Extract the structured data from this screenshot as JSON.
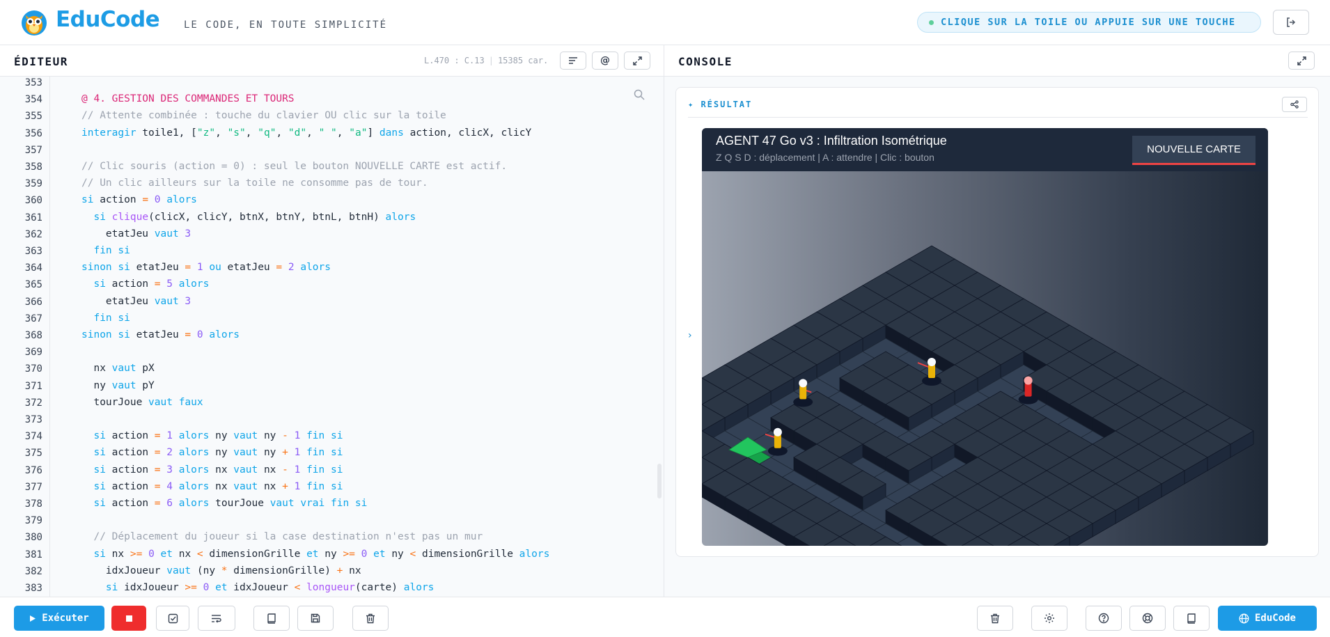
{
  "header": {
    "brand": "EduCode",
    "tagline": "LE CODE, EN TOUTE SIMPLICITÉ",
    "hint": "CLIQUE SUR LA TOILE OU APPUIE SUR UNE TOUCHE"
  },
  "editor": {
    "title": "ÉDITEUR",
    "cursor": "L.470 : C.13",
    "chars": "15385 car.",
    "first_line": 353,
    "lines": [
      [],
      [
        {
          "t": "@ 4. GESTION DES COMMANDES ET TOURS",
          "c": "sec"
        }
      ],
      [
        {
          "t": "// Attente combinée : touche du clavier OU clic sur la toile",
          "c": "cm"
        }
      ],
      [
        {
          "t": "interagir",
          "c": "kw"
        },
        {
          "t": " toile1, ["
        },
        {
          "t": "\"z\"",
          "c": "str"
        },
        {
          "t": ", "
        },
        {
          "t": "\"s\"",
          "c": "str"
        },
        {
          "t": ", "
        },
        {
          "t": "\"q\"",
          "c": "str"
        },
        {
          "t": ", "
        },
        {
          "t": "\"d\"",
          "c": "str"
        },
        {
          "t": ", "
        },
        {
          "t": "\" \"",
          "c": "str"
        },
        {
          "t": ", "
        },
        {
          "t": "\"a\"",
          "c": "str"
        },
        {
          "t": "] "
        },
        {
          "t": "dans",
          "c": "kw"
        },
        {
          "t": " action, clicX, clicY"
        }
      ],
      [],
      [
        {
          "t": "// Clic souris (action = 0) : seul le bouton NOUVELLE CARTE est actif.",
          "c": "cm"
        }
      ],
      [
        {
          "t": "// Un clic ailleurs sur la toile ne consomme pas de tour.",
          "c": "cm"
        }
      ],
      [
        {
          "t": "si",
          "c": "kw"
        },
        {
          "t": " action "
        },
        {
          "t": "=",
          "c": "op"
        },
        {
          "t": " "
        },
        {
          "t": "0",
          "c": "num"
        },
        {
          "t": " "
        },
        {
          "t": "alors",
          "c": "kw"
        }
      ],
      [
        {
          "t": "  "
        },
        {
          "t": "si",
          "c": "kw"
        },
        {
          "t": " "
        },
        {
          "t": "clique",
          "c": "fn"
        },
        {
          "t": "(clicX, clicY, btnX, btnY, btnL, btnH) "
        },
        {
          "t": "alors",
          "c": "kw"
        }
      ],
      [
        {
          "t": "    etatJeu "
        },
        {
          "t": "vaut",
          "c": "kw"
        },
        {
          "t": " "
        },
        {
          "t": "3",
          "c": "num"
        }
      ],
      [
        {
          "t": "  "
        },
        {
          "t": "fin si",
          "c": "kw"
        }
      ],
      [
        {
          "t": "sinon si",
          "c": "kw"
        },
        {
          "t": " etatJeu "
        },
        {
          "t": "=",
          "c": "op"
        },
        {
          "t": " "
        },
        {
          "t": "1",
          "c": "num"
        },
        {
          "t": " "
        },
        {
          "t": "ou",
          "c": "kw"
        },
        {
          "t": " etatJeu "
        },
        {
          "t": "=",
          "c": "op"
        },
        {
          "t": " "
        },
        {
          "t": "2",
          "c": "num"
        },
        {
          "t": " "
        },
        {
          "t": "alors",
          "c": "kw"
        }
      ],
      [
        {
          "t": "  "
        },
        {
          "t": "si",
          "c": "kw"
        },
        {
          "t": " action "
        },
        {
          "t": "=",
          "c": "op"
        },
        {
          "t": " "
        },
        {
          "t": "5",
          "c": "num"
        },
        {
          "t": " "
        },
        {
          "t": "alors",
          "c": "kw"
        }
      ],
      [
        {
          "t": "    etatJeu "
        },
        {
          "t": "vaut",
          "c": "kw"
        },
        {
          "t": " "
        },
        {
          "t": "3",
          "c": "num"
        }
      ],
      [
        {
          "t": "  "
        },
        {
          "t": "fin si",
          "c": "kw"
        }
      ],
      [
        {
          "t": "sinon si",
          "c": "kw"
        },
        {
          "t": " etatJeu "
        },
        {
          "t": "=",
          "c": "op"
        },
        {
          "t": " "
        },
        {
          "t": "0",
          "c": "num"
        },
        {
          "t": " "
        },
        {
          "t": "alors",
          "c": "kw"
        }
      ],
      [],
      [
        {
          "t": "  nx "
        },
        {
          "t": "vaut",
          "c": "kw"
        },
        {
          "t": " pX"
        }
      ],
      [
        {
          "t": "  ny "
        },
        {
          "t": "vaut",
          "c": "kw"
        },
        {
          "t": " pY"
        }
      ],
      [
        {
          "t": "  tourJoue "
        },
        {
          "t": "vaut",
          "c": "kw"
        },
        {
          "t": " "
        },
        {
          "t": "faux",
          "c": "kw"
        }
      ],
      [],
      [
        {
          "t": "  "
        },
        {
          "t": "si",
          "c": "kw"
        },
        {
          "t": " action "
        },
        {
          "t": "=",
          "c": "op"
        },
        {
          "t": " "
        },
        {
          "t": "1",
          "c": "num"
        },
        {
          "t": " "
        },
        {
          "t": "alors",
          "c": "kw"
        },
        {
          "t": " ny "
        },
        {
          "t": "vaut",
          "c": "kw"
        },
        {
          "t": " ny "
        },
        {
          "t": "-",
          "c": "op"
        },
        {
          "t": " "
        },
        {
          "t": "1",
          "c": "num"
        },
        {
          "t": " "
        },
        {
          "t": "fin si",
          "c": "kw"
        }
      ],
      [
        {
          "t": "  "
        },
        {
          "t": "si",
          "c": "kw"
        },
        {
          "t": " action "
        },
        {
          "t": "=",
          "c": "op"
        },
        {
          "t": " "
        },
        {
          "t": "2",
          "c": "num"
        },
        {
          "t": " "
        },
        {
          "t": "alors",
          "c": "kw"
        },
        {
          "t": " ny "
        },
        {
          "t": "vaut",
          "c": "kw"
        },
        {
          "t": " ny "
        },
        {
          "t": "+",
          "c": "op"
        },
        {
          "t": " "
        },
        {
          "t": "1",
          "c": "num"
        },
        {
          "t": " "
        },
        {
          "t": "fin si",
          "c": "kw"
        }
      ],
      [
        {
          "t": "  "
        },
        {
          "t": "si",
          "c": "kw"
        },
        {
          "t": " action "
        },
        {
          "t": "=",
          "c": "op"
        },
        {
          "t": " "
        },
        {
          "t": "3",
          "c": "num"
        },
        {
          "t": " "
        },
        {
          "t": "alors",
          "c": "kw"
        },
        {
          "t": " nx "
        },
        {
          "t": "vaut",
          "c": "kw"
        },
        {
          "t": " nx "
        },
        {
          "t": "-",
          "c": "op"
        },
        {
          "t": " "
        },
        {
          "t": "1",
          "c": "num"
        },
        {
          "t": " "
        },
        {
          "t": "fin si",
          "c": "kw"
        }
      ],
      [
        {
          "t": "  "
        },
        {
          "t": "si",
          "c": "kw"
        },
        {
          "t": " action "
        },
        {
          "t": "=",
          "c": "op"
        },
        {
          "t": " "
        },
        {
          "t": "4",
          "c": "num"
        },
        {
          "t": " "
        },
        {
          "t": "alors",
          "c": "kw"
        },
        {
          "t": " nx "
        },
        {
          "t": "vaut",
          "c": "kw"
        },
        {
          "t": " nx "
        },
        {
          "t": "+",
          "c": "op"
        },
        {
          "t": " "
        },
        {
          "t": "1",
          "c": "num"
        },
        {
          "t": " "
        },
        {
          "t": "fin si",
          "c": "kw"
        }
      ],
      [
        {
          "t": "  "
        },
        {
          "t": "si",
          "c": "kw"
        },
        {
          "t": " action "
        },
        {
          "t": "=",
          "c": "op"
        },
        {
          "t": " "
        },
        {
          "t": "6",
          "c": "num"
        },
        {
          "t": " "
        },
        {
          "t": "alors",
          "c": "kw"
        },
        {
          "t": " tourJoue "
        },
        {
          "t": "vaut",
          "c": "kw"
        },
        {
          "t": " "
        },
        {
          "t": "vrai",
          "c": "kw"
        },
        {
          "t": " "
        },
        {
          "t": "fin si",
          "c": "kw"
        }
      ],
      [],
      [
        {
          "t": "  "
        },
        {
          "t": "// Déplacement du joueur si la case destination n'est pas un mur",
          "c": "cm"
        }
      ],
      [
        {
          "t": "  "
        },
        {
          "t": "si",
          "c": "kw"
        },
        {
          "t": " nx "
        },
        {
          "t": ">=",
          "c": "op"
        },
        {
          "t": " "
        },
        {
          "t": "0",
          "c": "num"
        },
        {
          "t": " "
        },
        {
          "t": "et",
          "c": "kw"
        },
        {
          "t": " nx "
        },
        {
          "t": "<",
          "c": "op"
        },
        {
          "t": " dimensionGrille "
        },
        {
          "t": "et",
          "c": "kw"
        },
        {
          "t": " ny "
        },
        {
          "t": ">=",
          "c": "op"
        },
        {
          "t": " "
        },
        {
          "t": "0",
          "c": "num"
        },
        {
          "t": " "
        },
        {
          "t": "et",
          "c": "kw"
        },
        {
          "t": " ny "
        },
        {
          "t": "<",
          "c": "op"
        },
        {
          "t": " dimensionGrille "
        },
        {
          "t": "alors",
          "c": "kw"
        }
      ],
      [
        {
          "t": "    idxJoueur "
        },
        {
          "t": "vaut",
          "c": "kw"
        },
        {
          "t": " (ny "
        },
        {
          "t": "*",
          "c": "op"
        },
        {
          "t": " dimensionGrille) "
        },
        {
          "t": "+",
          "c": "op"
        },
        {
          "t": " nx"
        }
      ],
      [
        {
          "t": "    "
        },
        {
          "t": "si",
          "c": "kw"
        },
        {
          "t": " idxJoueur "
        },
        {
          "t": ">=",
          "c": "op"
        },
        {
          "t": " "
        },
        {
          "t": "0",
          "c": "num"
        },
        {
          "t": " "
        },
        {
          "t": "et",
          "c": "kw"
        },
        {
          "t": " idxJoueur "
        },
        {
          "t": "<",
          "c": "op"
        },
        {
          "t": " "
        },
        {
          "t": "longueur",
          "c": "fn"
        },
        {
          "t": "(carte) "
        },
        {
          "t": "alors",
          "c": "kw"
        }
      ],
      []
    ]
  },
  "console": {
    "title": "CONSOLE",
    "result_label": "✦ RÉSULTAT",
    "side_chevron": "›",
    "game": {
      "title": "AGENT 47 Go v3 : Infiltration Isométrique",
      "subtitle": "Z Q S D : déplacement | A : attendre | Clic : bouton",
      "button": "NOUVELLE CARTE"
    }
  },
  "footer": {
    "run": "Exécuter",
    "educode": "EduCode"
  },
  "colors": {
    "accent": "#1d9be6",
    "stop": "#ef2d2d",
    "exit_tile": "#22c55e",
    "guard": "#eab308"
  }
}
